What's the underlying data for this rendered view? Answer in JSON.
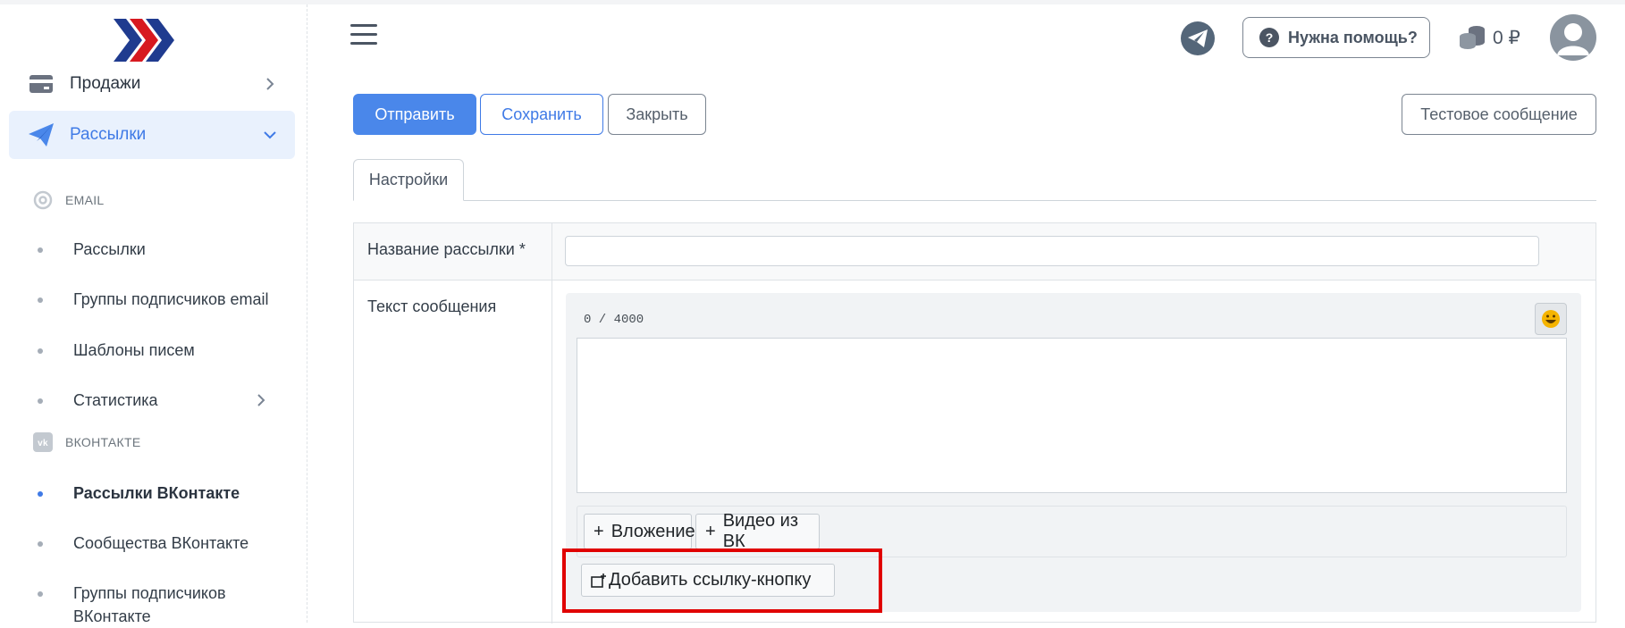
{
  "sidebar": {
    "menu": [
      {
        "label": "Продажи",
        "icon": "credit-card-icon"
      },
      {
        "label": "Рассылки",
        "icon": "paper-plane-icon"
      }
    ],
    "sections": {
      "email": "EMAIL",
      "vk": "ВКОНТАКТЕ"
    },
    "email_items": [
      {
        "label": "Рассылки"
      },
      {
        "label": "Группы подписчиков email"
      },
      {
        "label": "Шаблоны писем"
      },
      {
        "label": "Статистика"
      }
    ],
    "vk_items": [
      {
        "label": "Рассылки ВКонтакте"
      },
      {
        "label": "Сообщества ВКонтакте"
      },
      {
        "label": "Группы подписчиков ВКонтакте"
      }
    ]
  },
  "header": {
    "help_label": "Нужна помощь?",
    "help_icon_text": "?",
    "balance": "0 ₽"
  },
  "toolbar": {
    "send_label": "Отправить",
    "save_label": "Сохранить",
    "close_label": "Закрыть",
    "test_label": "Тестовое сообщение"
  },
  "tabs": [
    {
      "label": "Настройки"
    }
  ],
  "form": {
    "name_label": "Название рассылки *",
    "name_value": "",
    "text_label": "Текст сообщения",
    "counter": "0 / 4000",
    "message_value": "",
    "attach_label": "Вложение",
    "video_label": "Видео из ВК",
    "add_link_label": "Добавить ссылку-кнопку"
  },
  "colors": {
    "primary": "#4a87ea",
    "highlight": "#e00000",
    "active_bg": "#e9f1fd"
  }
}
